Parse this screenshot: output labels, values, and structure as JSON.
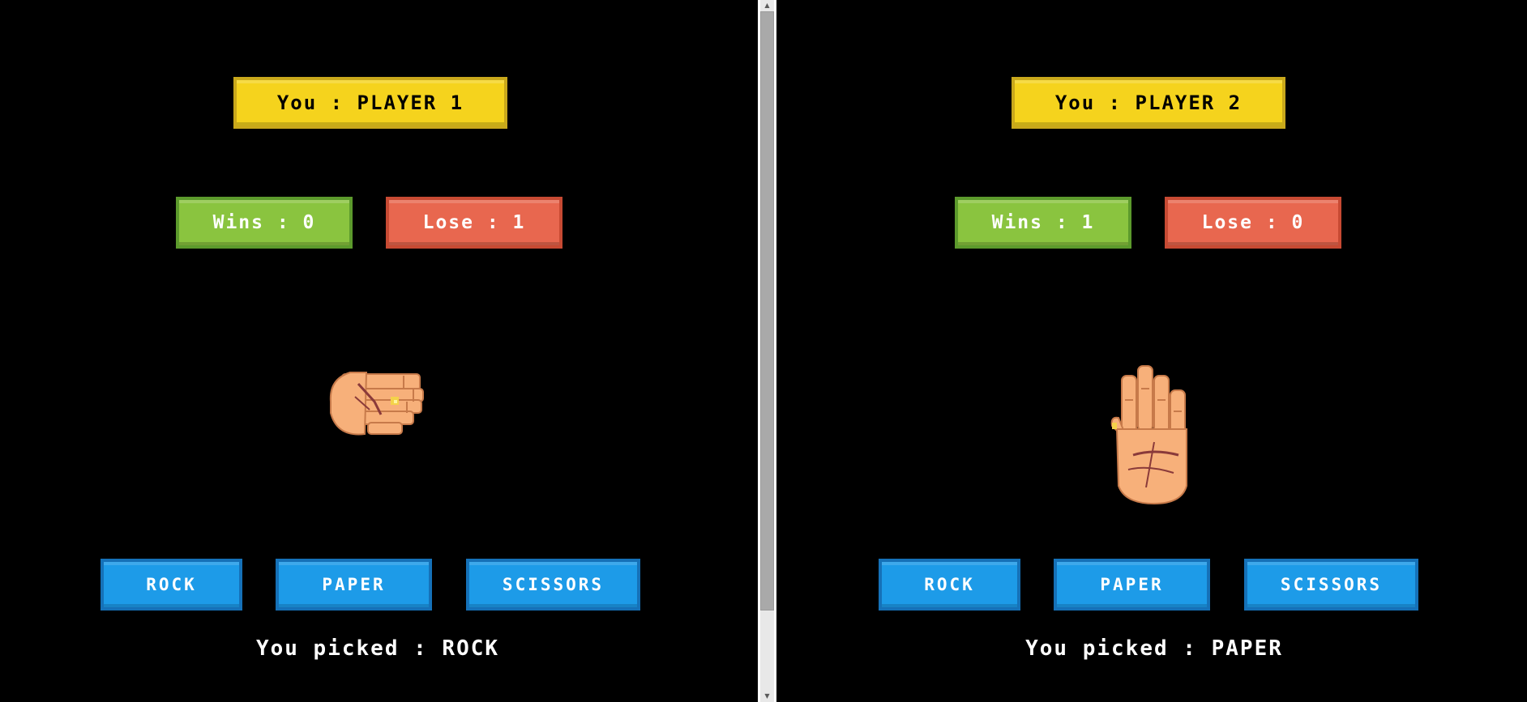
{
  "left_pane": {
    "player_label": "You : PLAYER 1",
    "wins_label": "Wins : 0",
    "lose_label": "Lose : 1",
    "hand_icon": "rock-hand-icon",
    "buttons": {
      "rock": "ROCK",
      "paper": "PAPER",
      "scissors": "SCISSORS"
    },
    "picked_label": "You picked : ROCK"
  },
  "right_pane": {
    "player_label": "You : PLAYER 2",
    "wins_label": "Wins : 1",
    "lose_label": "Lose : 0",
    "hand_icon": "paper-hand-icon",
    "buttons": {
      "rock": "ROCK",
      "paper": "PAPER",
      "scissors": "SCISSORS"
    },
    "picked_label": "You picked : PAPER"
  },
  "colors": {
    "background": "#000000",
    "player_box": "#f5d31d",
    "wins_box": "#8ac43f",
    "lose_box": "#e8674f",
    "button": "#1d9be8",
    "skin": "#f7b07a"
  }
}
